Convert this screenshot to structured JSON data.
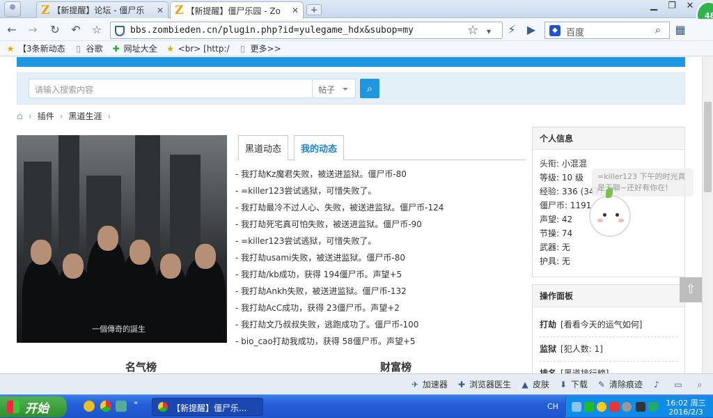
{
  "browser": {
    "tabs": [
      {
        "label": "【新提醒】论坛 - 僵尸乐",
        "active": false
      },
      {
        "label": "【新提醒】僵尸乐园 - Zo",
        "active": true
      }
    ],
    "url": "bbs.zombieden.cn/plugin.php?id=yulegame_hdx&subop=my",
    "search_engine_placeholder": "百度",
    "badge_count": "48",
    "bookmarks": [
      "【3条新动态",
      "谷歌",
      "网址大全",
      "<br> [http:/",
      "更多>>"
    ]
  },
  "site_search": {
    "placeholder": "请输入搜索内容",
    "scope": "帖子"
  },
  "breadcrumb": [
    "插件",
    "黑道生涯"
  ],
  "poster": {
    "caption": "一個傳奇的誕生"
  },
  "feed_tabs": [
    {
      "label": "黑道动态",
      "active": false
    },
    {
      "label": "我的动态",
      "active": true
    }
  ],
  "feed": [
    "- 我打劫Kz魔君失败，被送进监狱。僵尸币-80",
    "- =killer123尝试逃狱，可惜失败了。",
    "- 我打劫最冷不过人心、失败，被送进监狱。僵尸币-124",
    "- 我打劫死宅真可怕失败，被送进监狱。僵尸币-90",
    "- =killer123尝试逃狱，可惜失败了。",
    "- 我打劫usami失败，被送进监狱。僵尸币-80",
    "- 我打劫/kb成功，获得 194僵尸币。声望+5",
    "- 我打劫Ankh失败，被送进监狱。僵尸币-132",
    "- 我打劫AcC成功，获得 23僵尸币。声望+2",
    "- 我打劫文乃叔叔失败，逃跑成功了。僵尸币-100",
    "- bio_cao打劫我成功，获得 58僵尸币。声望+5"
  ],
  "rankings": {
    "fame": "名气榜",
    "wealth": "财富榜"
  },
  "info_panel": {
    "title": "个人信息",
    "rows": [
      "头衔: 小混混",
      "等级: 10 级",
      "经验: 336 (347)",
      "僵尸币: 1191",
      "声望: 42",
      "节操: 74",
      "武器: 无",
      "护具: 无"
    ]
  },
  "ops_panel": {
    "title": "操作面板",
    "items": [
      {
        "name": "打劫",
        "desc": "[看看今天的运气如何]"
      },
      {
        "name": "监狱",
        "desc": "[犯人数: 1]"
      },
      {
        "name": "排名",
        "desc": "[黑道排行榜]"
      }
    ]
  },
  "chat_bubble": "=killer123 下午的时光真是无聊~还好有你在!",
  "statusbar": [
    "加速器",
    "浏览器医生",
    "皮肤",
    "下载",
    "清除痕迹"
  ],
  "taskbar": {
    "start": "开始",
    "task": "【新提醒】僵尸乐...",
    "lang": "CH",
    "time": "16:02 周三",
    "date": "2016/2/3"
  },
  "colors": {
    "accent": "#1e97e0",
    "active_tab_text": "#1e82d6"
  }
}
